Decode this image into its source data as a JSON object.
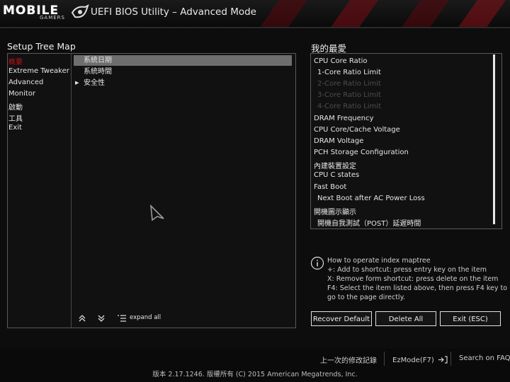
{
  "header": {
    "logo_text": "MOBILE",
    "logo_sub": "GAMERS",
    "title": "UEFI BIOS Utility – Advanced Mode"
  },
  "tree": {
    "section_title": "Setup Tree Map",
    "menu": [
      {
        "label": "概要",
        "active": true
      },
      {
        "label": "Extreme Tweaker"
      },
      {
        "label": "Advanced"
      },
      {
        "label": "Monitor"
      },
      {
        "label": "啟動"
      },
      {
        "label": "工具"
      },
      {
        "label": "Exit"
      }
    ],
    "subitems": [
      {
        "label": "系統日期",
        "selected": true
      },
      {
        "label": "系統時間"
      },
      {
        "label": "安全性",
        "expandable": true
      }
    ],
    "expand_all_label": "expand all"
  },
  "favorites": {
    "section_title": "我的最愛",
    "items": [
      {
        "label": "CPU Core Ratio"
      },
      {
        "label": "1-Core Ratio Limit",
        "indent": true
      },
      {
        "label": "2-Core Ratio Limit",
        "indent": true,
        "disabled": true
      },
      {
        "label": "3-Core Ratio Limit",
        "indent": true,
        "disabled": true
      },
      {
        "label": "4-Core Ratio Limit",
        "indent": true,
        "disabled": true
      },
      {
        "label": "DRAM Frequency"
      },
      {
        "label": "CPU Core/Cache Voltage"
      },
      {
        "label": "DRAM Voltage"
      },
      {
        "label": "PCH Storage Configuration"
      },
      {
        "label": "內建裝置設定"
      },
      {
        "label": "CPU C states"
      },
      {
        "label": "Fast Boot"
      },
      {
        "label": "Next Boot after AC Power Loss",
        "indent": true
      },
      {
        "label": "開機圖示顯示"
      },
      {
        "label": "開機自我測試（POST）延遲時間",
        "indent": true
      }
    ],
    "help": [
      "How to operate index maptree",
      "+: Add to shortcut: press entry key on the item",
      "X: Remove form shortcut: press delete on the item",
      "F4: Select the item listed above, then press F4 key to",
      "go to the page directly."
    ],
    "buttons": {
      "recover": "Recover Default",
      "delete": "Delete All",
      "exit": "Exit (ESC)"
    }
  },
  "footer": {
    "last_modified": "上一次的修改記錄",
    "ezmode": "EzMode(F7)",
    "search": "Search on FAQ",
    "copyright": "版本 2.17.1246. 版權所有 (C) 2015 American Megatrends, Inc."
  },
  "colors": {
    "accent": "#c0101a",
    "selected_row": "#6e6e6e",
    "border": "#5a5a5a"
  }
}
